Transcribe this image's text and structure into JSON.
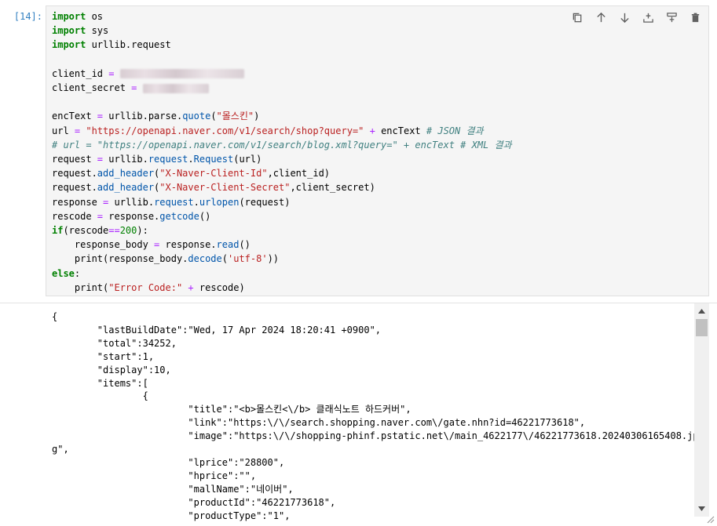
{
  "cell": {
    "prompt": "[14]:",
    "code": {
      "l1": {
        "kw": "import",
        "rest": " os"
      },
      "l2": {
        "kw": "import",
        "rest": " sys"
      },
      "l3": {
        "kw": "import",
        "rest": " urllib.request"
      },
      "l5": {
        "name": "client_id",
        "eq": " = "
      },
      "l6": {
        "name": "client_secret",
        "eq": " = "
      },
      "l8": {
        "a": "encText ",
        "eq": "=",
        "b": " urllib.parse.",
        "fn": "quote",
        "c": "(",
        "str": "\"몰스킨\"",
        "d": ")"
      },
      "l9": {
        "a": "url ",
        "eq": "=",
        "sp": " ",
        "str": "\"https://openapi.naver.com/v1/search/shop?query=\"",
        "sp2": " ",
        "plus": "+",
        "b": " encText ",
        "com": "# JSON 결과"
      },
      "l10": {
        "com": "# url = \"https://openapi.naver.com/v1/search/blog.xml?query=\" + encText # XML 결과"
      },
      "l11": {
        "a": "request ",
        "eq": "=",
        "b": " urllib.",
        "fn1": "request",
        "c": ".",
        "fn2": "Request",
        "d": "(url)"
      },
      "l12": {
        "a": "request.",
        "fn": "add_header",
        "b": "(",
        "str": "\"X-Naver-Client-Id\"",
        "c": ",client_id)"
      },
      "l13": {
        "a": "request.",
        "fn": "add_header",
        "b": "(",
        "str": "\"X-Naver-Client-Secret\"",
        "c": ",client_secret)"
      },
      "l14": {
        "a": "response ",
        "eq": "=",
        "b": " urllib.",
        "fn1": "request",
        "c": ".",
        "fn2": "urlopen",
        "d": "(request)"
      },
      "l15": {
        "a": "rescode ",
        "eq": "=",
        "b": " response.",
        "fn": "getcode",
        "c": "()"
      },
      "l16": {
        "kw": "if",
        "a": "(rescode",
        "eq": "==",
        "num": "200",
        "b": "):"
      },
      "l17": {
        "a": "    response_body ",
        "eq": "=",
        "b": " response.",
        "fn": "read",
        "c": "()"
      },
      "l18": {
        "a": "    print(response_body.",
        "fn": "decode",
        "b": "(",
        "str": "'utf-8'",
        "c": "))"
      },
      "l19": {
        "kw": "else",
        "a": ":"
      },
      "l20": {
        "a": "    print(",
        "str": "\"Error Code:\"",
        "sp": " ",
        "plus": "+",
        "b": " rescode)"
      }
    }
  },
  "toolbar": {
    "icons": [
      "duplicate-icon",
      "move-up-icon",
      "move-down-icon",
      "insert-above-icon",
      "insert-below-icon",
      "delete-icon"
    ]
  },
  "output": {
    "lines": [
      "{",
      "        \"lastBuildDate\":\"Wed, 17 Apr 2024 18:20:41 +0900\",",
      "        \"total\":34252,",
      "        \"start\":1,",
      "        \"display\":10,",
      "        \"items\":[",
      "                {",
      "                        \"title\":\"<b>몰스킨<\\/b> 클래식노트 하드커버\",",
      "                        \"link\":\"https:\\/\\/search.shopping.naver.com\\/gate.nhn?id=46221773618\",",
      "                        \"image\":\"https:\\/\\/shopping-phinf.pstatic.net\\/main_4622177\\/46221773618.20240306165408.jp",
      "g\",",
      "                        \"lprice\":\"28800\",",
      "                        \"hprice\":\"\",",
      "                        \"mallName\":\"네이버\",",
      "                        \"productId\":\"46221773618\",",
      "                        \"productType\":\"1\","
    ]
  },
  "colors": {
    "prompt": "#307fc1",
    "keyword": "#008000",
    "string": "#ba2121",
    "operator": "#aa22ff",
    "comment": "#408080",
    "cell_bg": "#f5f5f5"
  }
}
